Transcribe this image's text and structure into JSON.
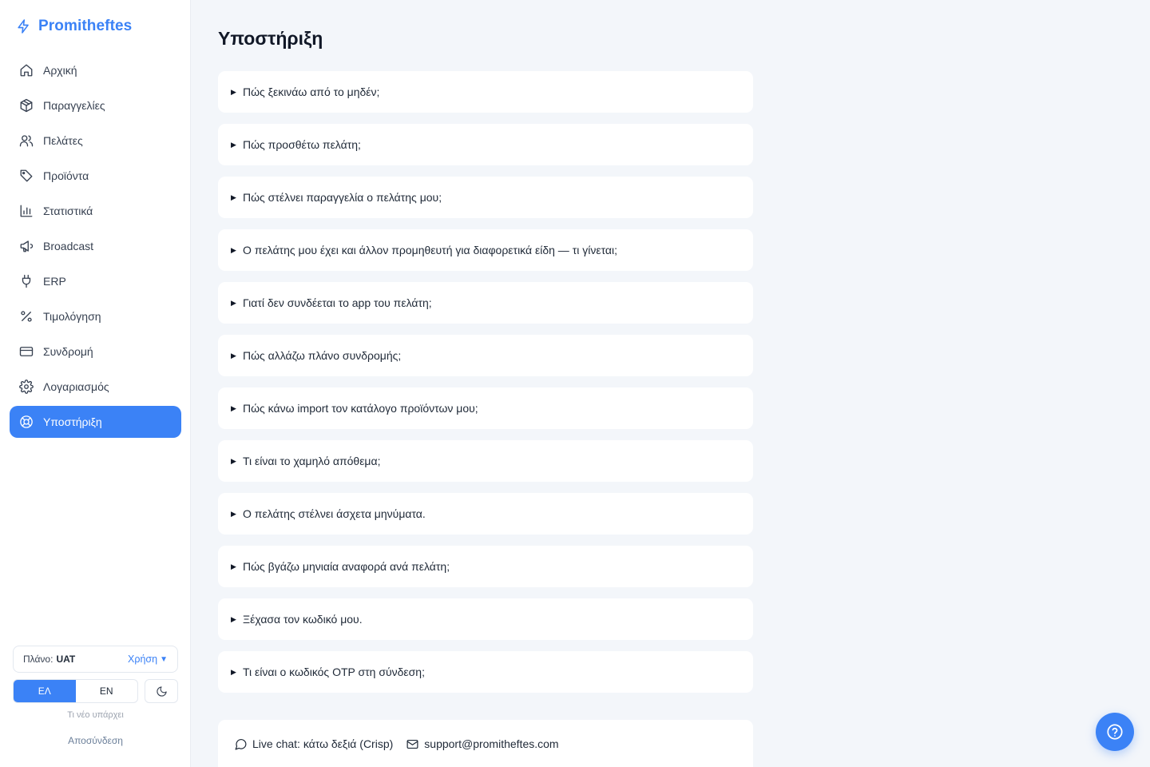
{
  "brand": {
    "name": "Promitheftes",
    "icon": "lightning-icon",
    "color": "#3b82f6"
  },
  "sidebar": {
    "items": [
      {
        "label": "Αρχική",
        "icon": "home-icon"
      },
      {
        "label": "Παραγγελίες",
        "icon": "package-icon"
      },
      {
        "label": "Πελάτες",
        "icon": "users-icon"
      },
      {
        "label": "Προϊόντα",
        "icon": "tag-icon"
      },
      {
        "label": "Στατιστικά",
        "icon": "bar-chart-icon"
      },
      {
        "label": "Broadcast",
        "icon": "megaphone-icon"
      },
      {
        "label": "ERP",
        "icon": "plug-icon"
      },
      {
        "label": "Τιμολόγηση",
        "icon": "percent-icon"
      },
      {
        "label": "Συνδρομή",
        "icon": "credit-card-icon"
      },
      {
        "label": "Λογαριασμός",
        "icon": "gear-icon"
      },
      {
        "label": "Υποστήριξη",
        "icon": "lifebuoy-icon",
        "active": true
      }
    ],
    "plan": {
      "label": "Πλάνο:",
      "value": "UAT",
      "usage_label": "Χρήση",
      "usage_caret": "▼"
    },
    "languages": [
      {
        "code": "ΕΛ",
        "active": true
      },
      {
        "code": "EN",
        "active": false
      }
    ],
    "theme_icon": "moon-icon",
    "whats_new": "Τι νέο υπάρχει",
    "logout": "Αποσύνδεση"
  },
  "main": {
    "title": "Υποστήριξη",
    "faq_marker": "▶",
    "faqs": [
      "Πώς ξεκινάω από το μηδέν;",
      "Πώς προσθέτω πελάτη;",
      "Πώς στέλνει παραγγελία ο πελάτης μου;",
      "Ο πελάτης μου έχει και άλλον προμηθευτή για διαφορετικά είδη — τι γίνεται;",
      "Γιατί δεν συνδέεται το app του πελάτη;",
      "Πώς αλλάζω πλάνο συνδρομής;",
      "Πώς κάνω import τον κατάλογο προϊόντων μου;",
      "Τι είναι το χαμηλό απόθεμα;",
      "Ο πελάτης στέλνει άσχετα μηνύματα.",
      "Πώς βγάζω μηνιαία αναφορά ανά πελάτη;",
      "Ξέχασα τον κωδικό μου.",
      "Τι είναι ο κωδικός OTP στη σύνδεση;"
    ],
    "contact": {
      "live_chat": "Live chat: κάτω δεξιά (Crisp)",
      "email": "support@promitheftes.com"
    }
  },
  "help_button_icon": "help-circle-icon"
}
